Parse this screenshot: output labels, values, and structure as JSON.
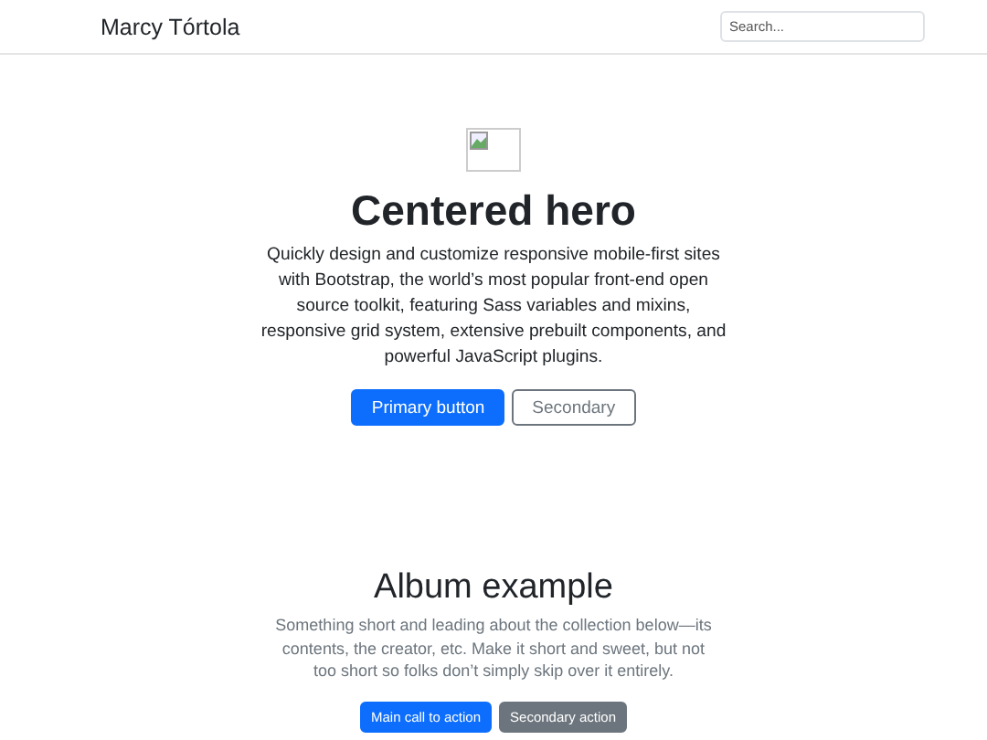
{
  "navbar": {
    "brand": "Marcy Tórtola",
    "search": {
      "placeholder": "Search..."
    }
  },
  "hero": {
    "image": {
      "kind": "broken-image"
    },
    "title": "Centered hero",
    "lead": "Quickly design and customize responsive mobile-first sites with Bootstrap, the world’s most popular front-end open source toolkit, featuring Sass variables and mixins, responsive grid system, extensive prebuilt components, and powerful JavaScript plugins.",
    "buttons": [
      {
        "label": "Primary button",
        "kind": "primary"
      },
      {
        "label": "Secondary",
        "kind": "outline"
      }
    ]
  },
  "album": {
    "title": "Album example",
    "lead": "Something short and leading about the collection below—its contents, the creator, etc. Make it short and sweet, but not too short so folks don’t simply skip over it entirely.",
    "buttons": [
      {
        "label": "Main call to action",
        "kind": "primary"
      },
      {
        "label": "Secondary action",
        "kind": "secondary"
      }
    ]
  }
}
